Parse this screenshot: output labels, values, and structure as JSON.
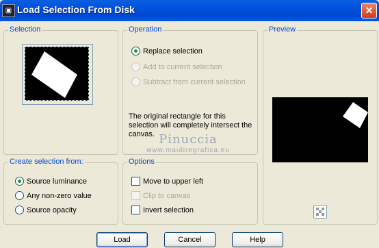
{
  "window": {
    "title": "Load Selection From Disk",
    "close_symbol": "✕",
    "icon": "app-icon"
  },
  "selection_group": {
    "legend": "Selection"
  },
  "operation_group": {
    "legend": "Operation",
    "options": [
      {
        "label": "Replace selection",
        "checked": true,
        "disabled": false
      },
      {
        "label": "Add to current selection",
        "checked": false,
        "disabled": true
      },
      {
        "label": "Subtract from current selection",
        "checked": false,
        "disabled": true
      }
    ],
    "info": "The original rectangle for this selection will completely intersect the canvas."
  },
  "preview_group": {
    "legend": "Preview"
  },
  "create_group": {
    "legend": "Create selection from:",
    "options": [
      {
        "label": "Source luminance",
        "checked": true
      },
      {
        "label": "Any non-zero value",
        "checked": false
      },
      {
        "label": "Source opacity",
        "checked": false
      }
    ]
  },
  "options_group": {
    "legend": "Options",
    "items": [
      {
        "label": "Move to upper left",
        "checked": false,
        "disabled": false
      },
      {
        "label": "Clip to canvas",
        "checked": false,
        "disabled": true
      },
      {
        "label": "Invert selection",
        "checked": false,
        "disabled": false
      }
    ]
  },
  "watermark": {
    "line1": "Pinuccia",
    "line2": "www.maidiregrafica.eu"
  },
  "buttons": {
    "load": "Load",
    "cancel": "Cancel",
    "help": "Help"
  },
  "colors": {
    "titlebar": "#0054E3",
    "dialog_bg": "#ECE9D8",
    "legend_text": "#0046D5",
    "radio_dot": "#21A121"
  }
}
